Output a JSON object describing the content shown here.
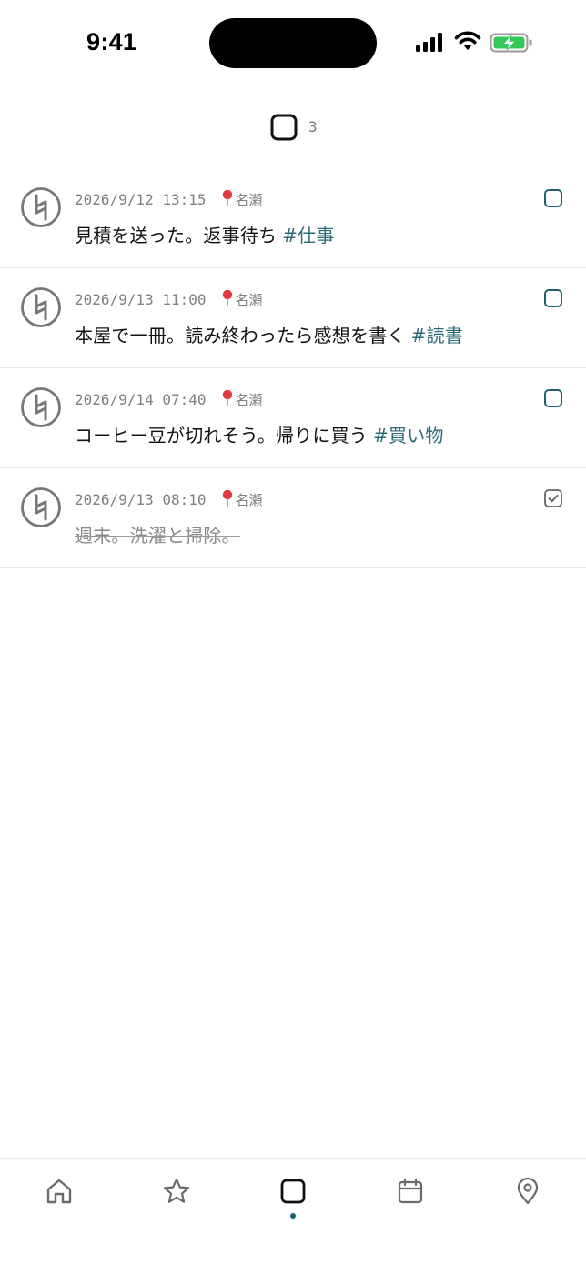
{
  "status_bar": {
    "time": "9:41"
  },
  "header": {
    "icon": "checkbox-square-icon",
    "count": "3"
  },
  "items": [
    {
      "date": "2026/9/12 13:15",
      "place": "名瀬",
      "text": "見積を送った。返事待ち",
      "tag": "#仕事",
      "done": false
    },
    {
      "date": "2026/9/13 11:00",
      "place": "名瀬",
      "text": "本屋で一冊。読み終わったら感想を書く",
      "tag": "#読書",
      "done": false
    },
    {
      "date": "2026/9/14 07:40",
      "place": "名瀬",
      "text": "コーヒー豆が切れそう。帰りに買う",
      "tag": "#買い物",
      "done": false
    },
    {
      "date": "2026/9/13 08:10",
      "place": "名瀬",
      "text": "週末。洗濯と掃除。",
      "tag": "",
      "done": true
    }
  ],
  "tabbar": {
    "tabs": [
      "home-icon",
      "star-icon",
      "todo-icon",
      "calendar-icon",
      "location-icon"
    ],
    "active": "todo-icon"
  },
  "colors": {
    "accent": "#1f5f6e",
    "tag": "#2c6a78",
    "meta": "#808080",
    "battery": "#34c759"
  }
}
